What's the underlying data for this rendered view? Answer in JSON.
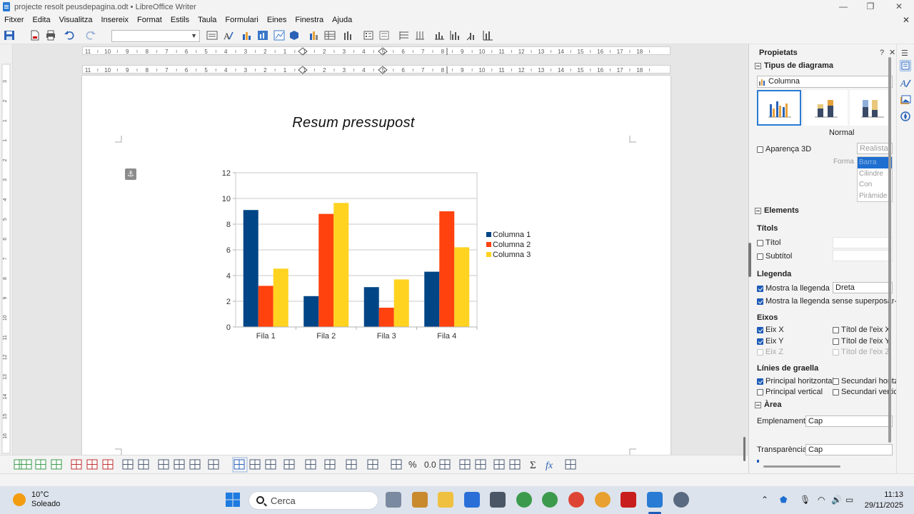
{
  "window": {
    "title": "projecte resolt peusdepagina.odt • LibreOffice Writer",
    "minimize": "—",
    "maximize": "❐",
    "close": "✕"
  },
  "menubar": {
    "items": [
      "Fitxer",
      "Edita",
      "Visualitza",
      "Insereix",
      "Format",
      "Estils",
      "Taula",
      "Formulari",
      "Eines",
      "Finestra",
      "Ajuda"
    ],
    "doc_close": "✕"
  },
  "toolbar": {
    "paragraph_style_value": "",
    "icons": [
      "save-icon",
      "export-pdf-icon",
      "print-icon",
      "undo-icon",
      "redo-icon",
      "paragraph-style-icon",
      "fontwork-icon",
      "chart-type-icon",
      "chart-area-icon",
      "chart-wall-icon",
      "3d-view-icon",
      "insert-chart-icon",
      "data-table-icon",
      "data-series-icon",
      "legend-on-off-icon",
      "legend-icon",
      "horizontal-grid-icon",
      "vertical-grid-icon",
      "x-axis-icon",
      "y-axis-icon",
      "z-axis-icon",
      "all-axes-icon"
    ]
  },
  "ruler": {
    "ticks": [
      "11",
      "10",
      "9",
      "8",
      "7",
      "6",
      "5",
      "4",
      "3",
      "2",
      "1",
      "1",
      "2",
      "3",
      "4",
      "5",
      "6",
      "7",
      "8",
      "9",
      "10",
      "11",
      "12",
      "13",
      "14",
      "15",
      "16",
      "17",
      "18"
    ],
    "vertical_ticks": [
      "3",
      "2",
      "1",
      "1",
      "2",
      "3",
      "4",
      "5",
      "6",
      "7",
      "8",
      "9",
      "10",
      "11",
      "12",
      "13",
      "14",
      "15",
      "16"
    ]
  },
  "document": {
    "heading": "Resum pressupost"
  },
  "chart_data": {
    "type": "bar",
    "title": "",
    "xlabel": "",
    "ylabel": "",
    "categories": [
      "Fila 1",
      "Fila 2",
      "Fila 3",
      "Fila 4"
    ],
    "series": [
      {
        "name": "Columna 1",
        "color": "#004586",
        "values": [
          9.1,
          2.4,
          3.1,
          4.3
        ]
      },
      {
        "name": "Columna 2",
        "color": "#ff420e",
        "values": [
          3.2,
          8.8,
          1.5,
          9.0
        ]
      },
      {
        "name": "Columna 3",
        "color": "#ffd320",
        "values": [
          4.54,
          9.65,
          3.7,
          6.2
        ]
      }
    ],
    "ylim": [
      0,
      12
    ],
    "yticks": [
      "0",
      "2",
      "4",
      "6",
      "8",
      "10",
      "12"
    ],
    "grid": "horizontal",
    "legend_position": "right"
  },
  "sidebar": {
    "title": "Propietats",
    "help": "?",
    "close": "✕",
    "chart_type_section": "Tipus de diagrama",
    "chart_type_value": "Columna",
    "variant_label": "Normal",
    "aparenca_3d": "Aparença 3D",
    "realista": "Realista",
    "forma_label": "Forma",
    "shapes": [
      "Barra",
      "Cilindre",
      "Con",
      "Piràmide"
    ],
    "elements_section": "Elements",
    "titols_heading": "Títols",
    "titol": "Títol",
    "subtitol": "Subtítol",
    "llegenda_heading": "Llegenda",
    "mostra_llegenda": "Mostra la llegenda",
    "legend_position_value": "Dreta",
    "mostra_llegenda_sense": "Mostra la llegenda sense superposar-la",
    "eixos_heading": "Eixos",
    "eix_x": "Eix X",
    "eix_y": "Eix Y",
    "eix_z": "Eix Z",
    "titol_eix_x": "Títol de l'eix X",
    "titol_eix_y": "Títol de l'eix Y",
    "titol_eix_z": "Títol de l'eix Z",
    "linies_heading": "Línies de graella",
    "principal_horitzontal": "Principal horitzontal",
    "secundari_horitzontal": "Secundari horitzontal",
    "principal_vertical": "Principal vertical",
    "secundari_vertical": "Secundari vertical",
    "area_section": "Àrea",
    "emplenament_label": "Emplenament:",
    "emplenament_value": "Cap",
    "transparencia_label": "Transparència:",
    "transparencia_value": "Cap"
  },
  "deck": {
    "icons": [
      "properties-icon",
      "styles-icon",
      "gallery-icon",
      "navigator-icon"
    ]
  },
  "taskbar": {
    "temperature": "10°C",
    "weather": "Soleado",
    "search_placeholder": "Cerca",
    "time": "11:13",
    "date": "29/11/2025"
  }
}
